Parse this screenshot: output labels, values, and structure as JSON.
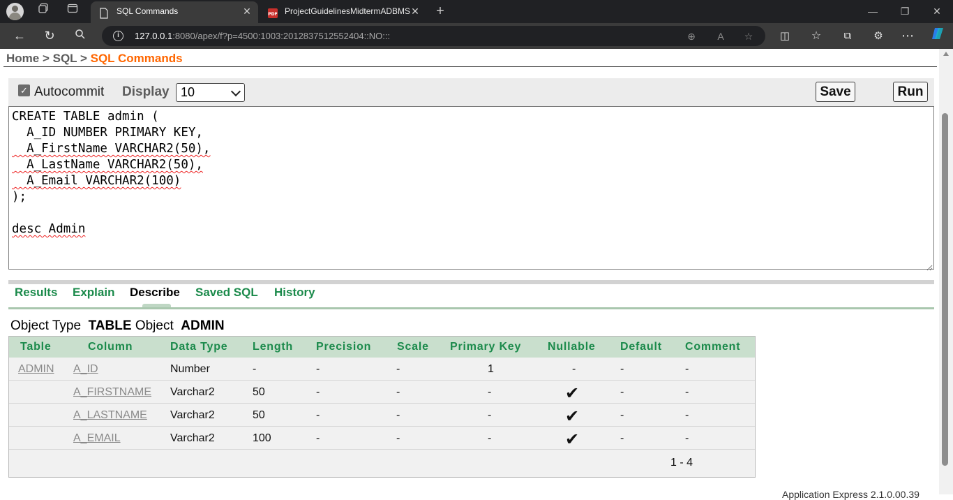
{
  "browser": {
    "tabs": [
      {
        "label": "SQL Commands",
        "active": true,
        "icon": "page-icon"
      },
      {
        "label": "ProjectGuidelinesMidtermADBMS",
        "active": false,
        "icon": "pdf-icon"
      }
    ],
    "address": {
      "host": "127.0.0.1",
      "rest": ":8080/apex/f?p=4500:1003:2012837512552404::NO:::"
    }
  },
  "breadcrumb": {
    "home": "Home",
    "sep1": " > ",
    "sql": "SQL",
    "sep2": " > ",
    "current": "SQL Commands"
  },
  "toolbar": {
    "autocommit_label": "Autocommit",
    "autocommit_checked": true,
    "display_label": "Display",
    "display_value": "10",
    "save_label": "Save",
    "run_label": "Run"
  },
  "sql_lines": [
    "CREATE TABLE admin (",
    "  A_ID NUMBER PRIMARY KEY,",
    "  A_FirstName VARCHAR2(50),",
    "  A_LastName VARCHAR2(50),",
    "  A_Email VARCHAR2(100)",
    ");",
    "",
    "desc Admin"
  ],
  "result_tabs": [
    "Results",
    "Explain",
    "Describe",
    "Saved SQL",
    "History"
  ],
  "active_result_tab": "Describe",
  "object_info": {
    "type_label": "Object Type",
    "type_value": "TABLE",
    "object_label": "Object",
    "object_value": "ADMIN"
  },
  "describe_table": {
    "headers": [
      "Table",
      "Column",
      "Data Type",
      "Length",
      "Precision",
      "Scale",
      "Primary Key",
      "Nullable",
      "Default",
      "Comment"
    ],
    "rows": [
      {
        "table": "ADMIN",
        "column": "A_ID",
        "data_type": "Number",
        "length": "-",
        "precision": "-",
        "scale": "-",
        "primary_key": "1",
        "nullable": "-",
        "default": "-",
        "comment": "-"
      },
      {
        "table": "",
        "column": "A_FIRSTNAME",
        "data_type": "Varchar2",
        "length": "50",
        "precision": "-",
        "scale": "-",
        "primary_key": "-",
        "nullable": "✔",
        "default": "-",
        "comment": "-"
      },
      {
        "table": "",
        "column": "A_LASTNAME",
        "data_type": "Varchar2",
        "length": "50",
        "precision": "-",
        "scale": "-",
        "primary_key": "-",
        "nullable": "✔",
        "default": "-",
        "comment": "-"
      },
      {
        "table": "",
        "column": "A_EMAIL",
        "data_type": "Varchar2",
        "length": "100",
        "precision": "-",
        "scale": "-",
        "primary_key": "-",
        "nullable": "✔",
        "default": "-",
        "comment": "-"
      }
    ],
    "pagination": "1 - 4"
  },
  "footer_peek": "Application Express 2.1.0.00.39",
  "colors": {
    "accent_orange": "#ff6600",
    "tab_green": "#1b8a4b",
    "header_green": "#c9dfcd"
  }
}
